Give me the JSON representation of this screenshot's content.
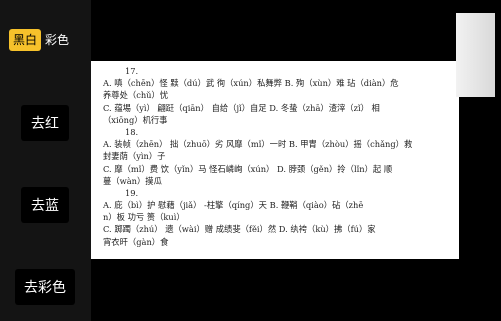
{
  "mode_toggle": {
    "options": [
      "黑白",
      "彩色"
    ],
    "selected": "黑白"
  },
  "tools": {
    "remove_red": "去红",
    "remove_blue": "去蓝",
    "remove_color": "去彩色"
  },
  "document": {
    "lines": [
      "17.",
      "A. 嗔（chēn）怪 黩（dú）武 徇（xún）私舞弊   B. 殉（xùn）难 玷（diàn）危",
      "养尊处（chǔ）忧",
      "C. 蕴埸（yì）  翩跹（qiān）  自给（jǐ）自足     D. 冬蛰（zhā）渣滓（zǐ）  相",
      "（xiōng）机行事",
      "18.",
      "A. 装帧（zhēn）  拙（zhuō）劣 风靡（mǐ）一时 B. 甲胄（zhòu）摇（chǎng）救",
      "封妻荫（yìn）子",
      "C. 靡（mǐ）费 饮（yǐn）马 怪石嶙峋（xún）      D. 脖颈（gěn）拎（lǐn）起 顺",
      "蔓（wàn）摸瓜",
      "19.",
      "A. 庇（bì）护 慰藉（jiǎ）  -柱擎（qíng）天     B. 鞭鞘（qiào）砧（zhē",
      "n）板 功亏  篑（kuì）",
      "C. 踯躅（zhú）  遗（wài）赠 成绩斐（fěi）然      D. 纨袴（kù）拂（fú）家",
      "宵衣旰（gàn）食"
    ]
  }
}
